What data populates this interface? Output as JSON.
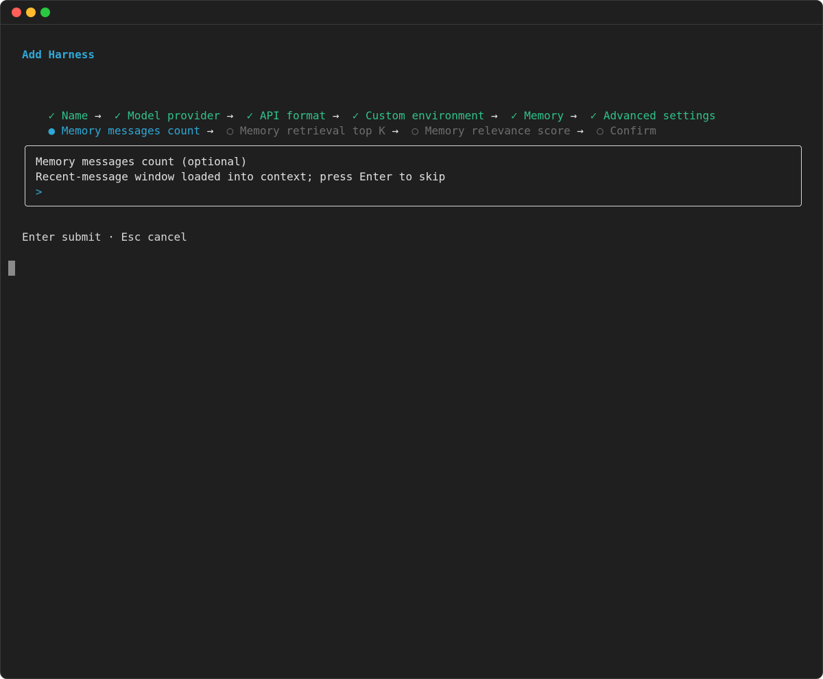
{
  "window": {
    "title": "Add Harness"
  },
  "steps": {
    "completed": [
      "Name",
      "Model provider",
      "API format",
      "Custom environment",
      "Memory",
      "Advanced settings"
    ],
    "current": "Memory messages count",
    "pending": [
      "Memory retrieval top K",
      "Memory relevance score",
      "Confirm"
    ],
    "check_glyph": "✓",
    "current_glyph": "●",
    "pending_glyph": "○",
    "arrow_glyph": "→"
  },
  "prompt_box": {
    "label": "Memory messages count (optional)",
    "description": "Recent-message window loaded into context; press Enter to skip",
    "prompt_symbol": ">",
    "value": ""
  },
  "footer": {
    "hint": "Enter submit · Esc cancel"
  },
  "colors": {
    "background": "#1f1f1f",
    "accent": "#2fa8d6",
    "done": "#2fc28a",
    "pending": "#6e6e6e"
  }
}
